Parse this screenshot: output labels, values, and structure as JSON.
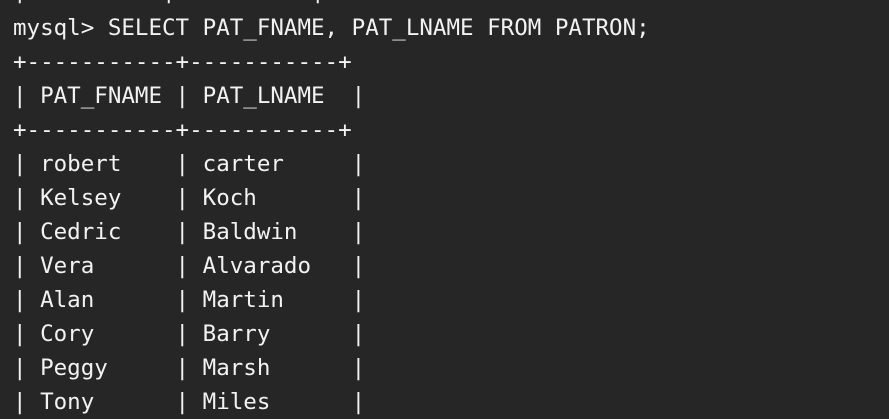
{
  "terminal": {
    "prev_line": "|          |          |",
    "command": "mysql> SELECT PAT_FNAME, PAT_LNAME FROM PATRON;",
    "border": "+-----------+-----------+",
    "header": "| PAT_FNAME | PAT_LNAME  |",
    "rows": [
      "| robert    | carter     |",
      "| Kelsey    | Koch       |",
      "| Cedric    | Baldwin    |",
      "| Vera      | Alvarado   |",
      "| Alan      | Martin     |",
      "| Cory      | Barry      |",
      "| Peggy     | Marsh      |",
      "| Tony      | Miles      |"
    ]
  }
}
